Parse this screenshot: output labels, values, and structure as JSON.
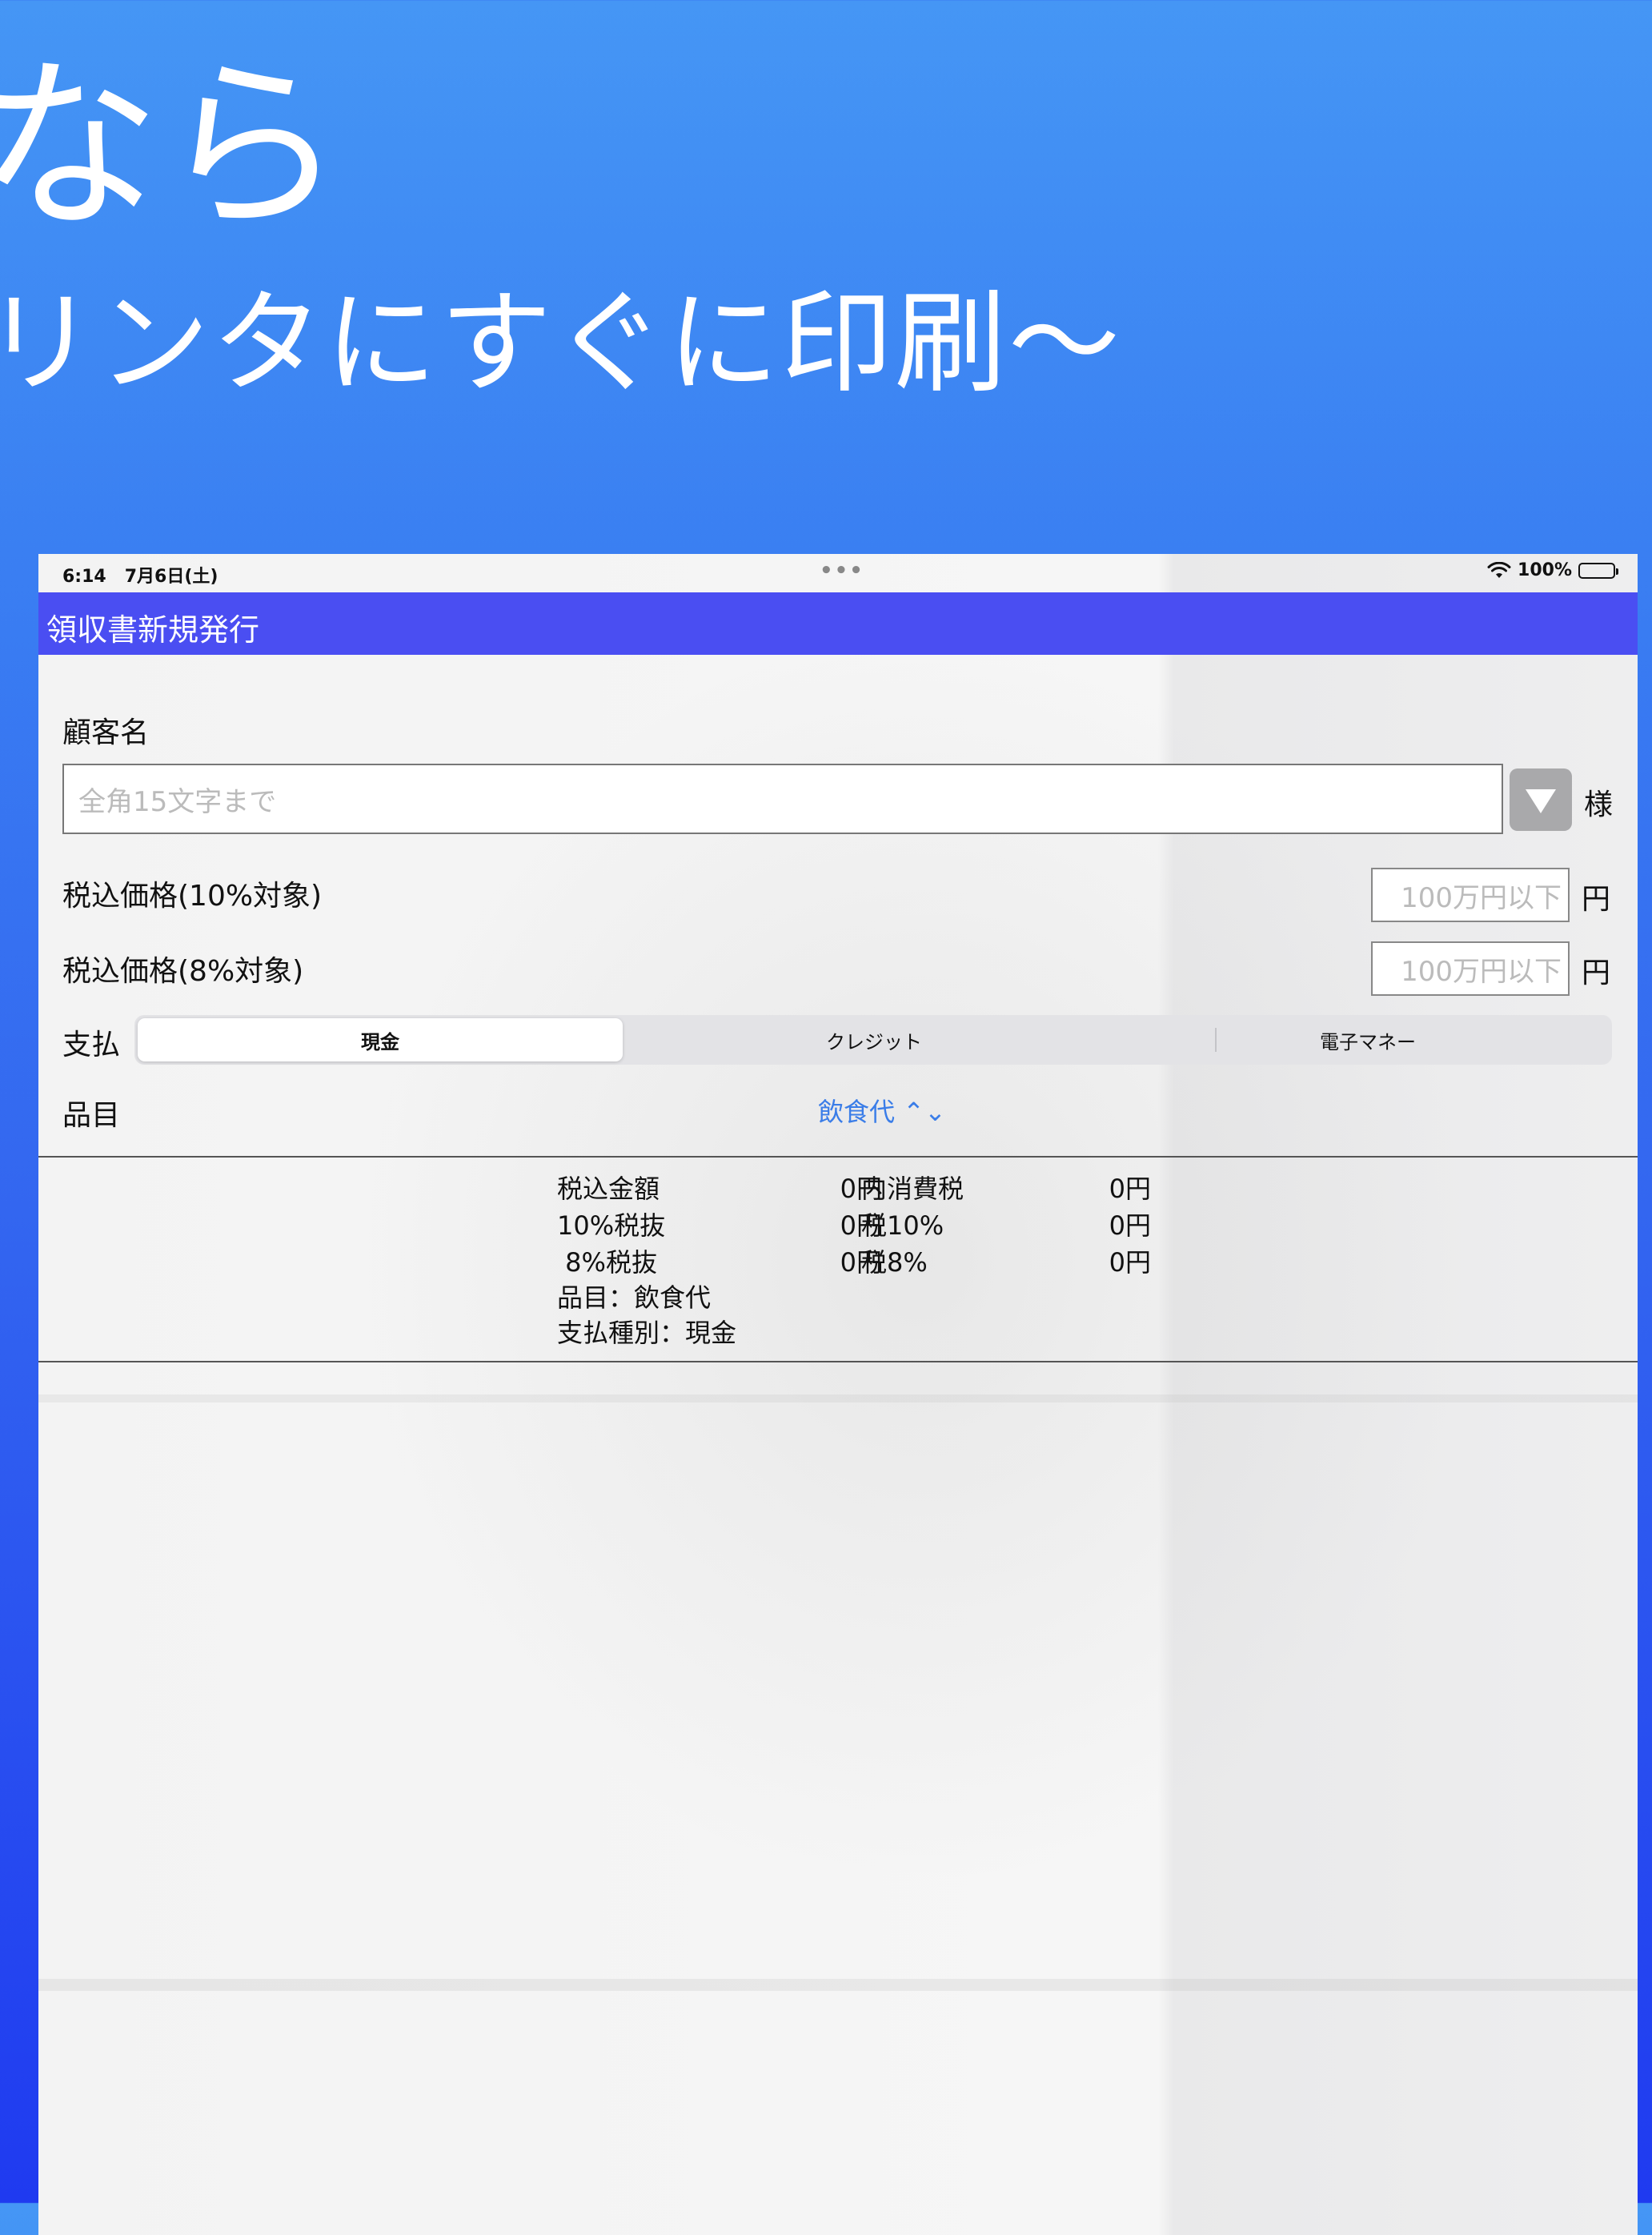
{
  "promo": {
    "line1": "なら",
    "line2": "リンタにすぐに印刷〜"
  },
  "status_bar": {
    "time": "6:14",
    "date": "7月6日(土)",
    "dots": "•••",
    "battery": "100%",
    "battery_level": 1.0
  },
  "nav": {
    "title": "領収書新規発行"
  },
  "form": {
    "customer_label": "顧客名",
    "customer_placeholder": "全角15文字まで",
    "customer_value": "",
    "honorific": "様",
    "price10_label": "税込価格(10%対象)",
    "price8_label": "税込価格(8%対象)",
    "price_placeholder": "100万円以下",
    "yen": "円",
    "payment_label": "支払",
    "payment_options": [
      "現金",
      "クレジット",
      "電子マネー"
    ],
    "payment_selected": "現金",
    "item_label": "品目",
    "item_value": "飲食代 ⌃⌄"
  },
  "summary": {
    "rows": [
      {
        "label": "税込金額",
        "value": "0円",
        "label2": "内消費税",
        "value2": "0円"
      },
      {
        "label": "10%税抜",
        "value": "0円",
        "label2": "税10%",
        "value2": "0円"
      },
      {
        "label": " 8%税抜",
        "value": "0円",
        "label2": "税8%",
        "value2": "0円"
      }
    ],
    "item_line": "品目：飲食代",
    "payment_line": "支払種別：現金"
  },
  "colors": {
    "nav_bg": "#4a4ef2",
    "accent_blue": "#3a7de8",
    "background_gradient_top": "#4596f5",
    "background_gradient_bottom": "#1f3af0"
  }
}
